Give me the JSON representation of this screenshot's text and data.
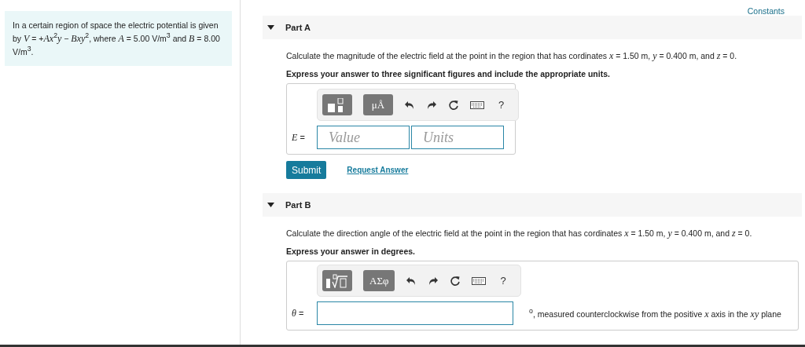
{
  "intro": {
    "text": "In a certain region of space the electric potential is given by *V* = +*Ax*$^{2}$*y* − *Bxy*$^{2}$, where *A* = 5.00 V/m$^{3}$ and *B* = 8.00 V/m$^{3}$."
  },
  "constants_link": "Constants",
  "parts": [
    {
      "title": "Part A",
      "expanded": true,
      "question": "Calculate the magnitude of the electric field at the point in the region that has cordinates *x* = 1.50 m, *y* = 0.400 m, and *z* = 0.",
      "instruction": "Express your answer to three significant figures and include the appropriate units.",
      "toolbar": [
        {
          "kind": "template"
        },
        {
          "kind": "symbols",
          "label": "μÅ"
        },
        {
          "kind": "undo"
        },
        {
          "kind": "redo"
        },
        {
          "kind": "reset"
        },
        {
          "kind": "keyboard"
        },
        {
          "kind": "help",
          "label": "?"
        }
      ],
      "answer": {
        "kind": "value_units",
        "variable": "*E* =",
        "fields": [
          {
            "placeholder": "Value"
          },
          {
            "placeholder": "Units"
          }
        ]
      },
      "submit": "Submit",
      "request": "Request Answer"
    },
    {
      "title": "Part B",
      "expanded": true,
      "question": "Calculate the direction angle of the electric field at the point in the region that has cordinates *x* = 1.50 m, *y* = 0.400 m, and *z* = 0.",
      "instruction": "Express your answer in degrees.",
      "toolbar": [
        {
          "kind": "root"
        },
        {
          "kind": "symbols",
          "label": "ΑΣφ"
        },
        {
          "kind": "undo"
        },
        {
          "kind": "redo"
        },
        {
          "kind": "reset"
        },
        {
          "kind": "keyboard"
        },
        {
          "kind": "help",
          "label": "?"
        }
      ],
      "answer": {
        "kind": "single",
        "variable": "*θ* =",
        "suffix": "$^{o}$, measured counterclockwise from the positive *x* axis in the *xy* plane"
      }
    }
  ]
}
